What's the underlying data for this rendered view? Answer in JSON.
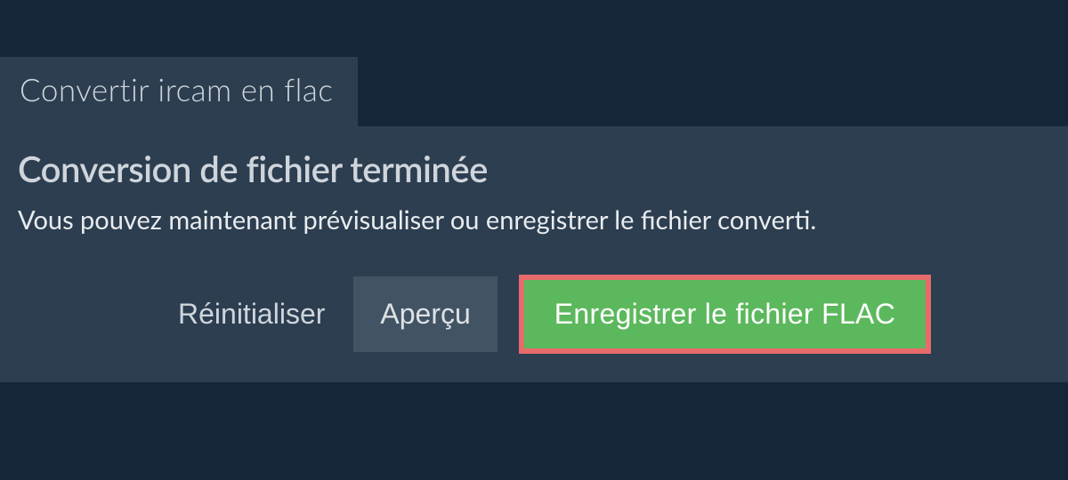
{
  "tab": {
    "label": "Convertir ircam en flac"
  },
  "panel": {
    "heading": "Conversion de fichier terminée",
    "description": "Vous pouvez maintenant prévisualiser ou enregistrer le fichier converti."
  },
  "buttons": {
    "reset": "Réinitialiser",
    "preview": "Aperçu",
    "save": "Enregistrer le fichier FLAC"
  }
}
